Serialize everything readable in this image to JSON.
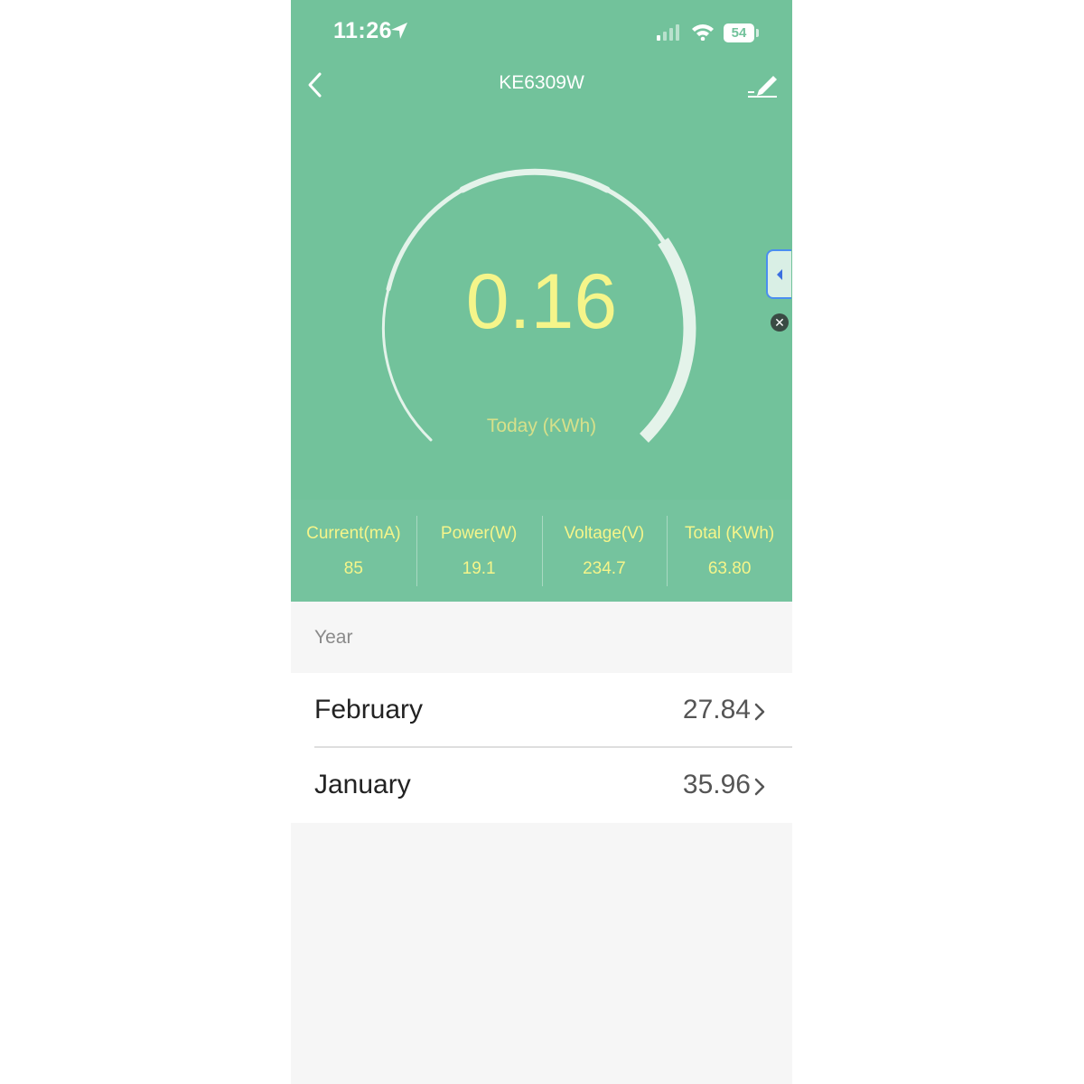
{
  "status": {
    "time": "11:26",
    "battery": "54"
  },
  "header": {
    "title": "KE6309W"
  },
  "gauge": {
    "value": "0.16",
    "label": "Today (KWh)"
  },
  "stats": [
    {
      "label": "Current(mA)",
      "value": "85"
    },
    {
      "label": "Power(W)",
      "value": "19.1"
    },
    {
      "label": "Voltage(V)",
      "value": "234.7"
    },
    {
      "label": "Total (KWh)",
      "value": "63.80"
    }
  ],
  "section": {
    "title": "Year"
  },
  "months": [
    {
      "label": "February",
      "value": "27.84"
    },
    {
      "label": "January",
      "value": "35.96"
    }
  ],
  "colors": {
    "header_green": "#72c29b",
    "value_yellow": "#f5f58a"
  },
  "icons": [
    "location-arrow-icon",
    "signal-icon",
    "wifi-icon",
    "battery-icon",
    "back-chevron-icon",
    "edit-pencil-icon",
    "side-tab-arrow-icon",
    "close-icon",
    "chevron-right-icon"
  ]
}
